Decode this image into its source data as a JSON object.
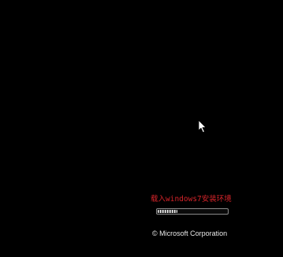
{
  "loading": {
    "text": "载入windows7安装环境",
    "text_color": "#d6242a",
    "progress_fraction": 0.28
  },
  "footer": {
    "copyright": "© Microsoft Corporation"
  },
  "cursor": {
    "icon": "arrow-cursor-icon"
  },
  "colors": {
    "background": "#000000",
    "text": "#e8e8e8"
  }
}
